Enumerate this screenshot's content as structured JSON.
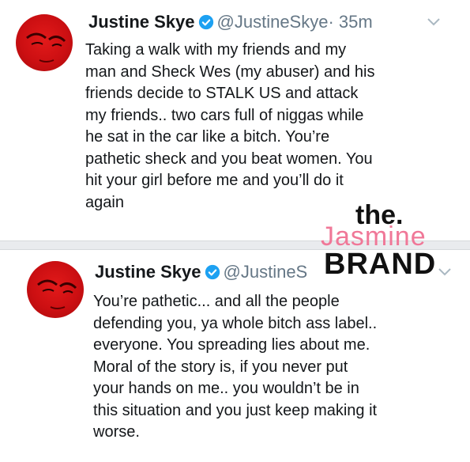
{
  "tweets": [
    {
      "name": "Justine Skye",
      "handle": "@JustineSkye",
      "time": "· 35m",
      "text": "Taking a walk with my friends and my\nman and Sheck Wes (my abuser) and his\nfriends decide to STALK US and attack\nmy friends.. two cars full of niggas while\nhe sat in the car like a bitch. You’re\npathetic sheck and you beat women. You\nhit your girl before me and you’ll do it\nagain"
    },
    {
      "name": "Justine Skye",
      "handle": "@JustineS",
      "time": "",
      "text": "You’re pathetic... and all the people\ndefending you, ya whole bitch ass label..\neveryone. You spreading lies about me.\nMoral of the story is, if you never put\nyour hands on me.. you wouldn’t be in\nthis situation and you just keep making it\nworse."
    }
  ],
  "watermark": {
    "line1": "the.",
    "line2": "Jasmine",
    "line3": "BRAND"
  },
  "icons": {
    "verified": "verified-badge-icon",
    "chevron": "chevron-down-icon"
  },
  "colors": {
    "verified": "#1da1f2",
    "handle": "#657786",
    "avatar": "#d4141a",
    "watermark_accent": "#f07898"
  }
}
